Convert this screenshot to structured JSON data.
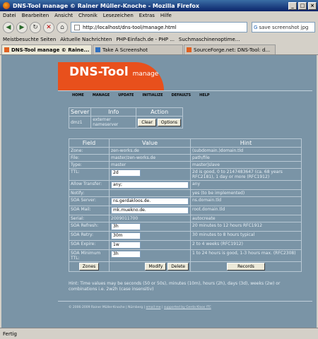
{
  "window": {
    "title": "DNS-Tool manage © Rainer Müller-Knoche - Mozilla Firefox"
  },
  "menubar": [
    "Datei",
    "Bearbeiten",
    "Ansicht",
    "Chronik",
    "Lesezeichen",
    "Extras",
    "Hilfe"
  ],
  "address": {
    "url": "http://localhost/dns-tool/manage.html"
  },
  "search": {
    "value": "save screenshot jpg"
  },
  "bookmarks": [
    "Meistbesuchte Seiten",
    "Aktuelle Nachrichten",
    "PHP-Einfach.de - PHP ...",
    "Suchmaschinenoptime..."
  ],
  "tabs": [
    "DNS-Tool manage © Raine...",
    "Take A Screenshot",
    "SourceForge.net: DNS-Tool: d..."
  ],
  "banner": {
    "title": "DNS-Tool",
    "subtitle": "manage"
  },
  "nav": [
    "HOME",
    "MANAGE",
    "UPDATE",
    "INITIALIZE",
    "DEFAULTS",
    "HELP"
  ],
  "actions_table": {
    "headers": {
      "server": "Server",
      "info": "Info",
      "action": "Action"
    },
    "row": {
      "server": "dmz1",
      "info": "externer nameserver",
      "clear": "Clear",
      "options": "Options"
    }
  },
  "fields_table": {
    "headers": {
      "field": "Field",
      "value": "Value",
      "hint": "Hint"
    },
    "rows": [
      {
        "field": "Zone:",
        "value": "zen-works.de",
        "input": false,
        "hint": "(subdomain.)domain.tld"
      },
      {
        "field": "File:",
        "value": "master/zen-works.de",
        "input": false,
        "hint": "path/file"
      },
      {
        "field": "Type:",
        "value": "master",
        "input": false,
        "hint": "master|slave"
      },
      {
        "field": "TTL:",
        "value": "2d",
        "input": true,
        "hint": "2d is good, 0 to 2147483647 (ca. 68 years RFC2181), 1 day or more (RFC1912)"
      },
      {
        "field": "Allow Transfer:",
        "value": "any;",
        "input": true,
        "hint": "any"
      },
      {
        "field": "Notify:",
        "value": "",
        "input": false,
        "hint": "yes (to be implemented)"
      },
      {
        "field": "SOA Server:",
        "value": "ns.gerdakloos.de.",
        "input": true,
        "hint": "ns.domain.tld"
      },
      {
        "field": "SOA Mail:",
        "value": "mk.muekno.de.",
        "input": true,
        "hint": "root.domain.tld"
      },
      {
        "field": "Serial:",
        "value": "2009011700",
        "input": false,
        "hint": "autocreate"
      },
      {
        "field": "SOA Refresh:",
        "value": "3h",
        "input": true,
        "hint": "20 minutes to 12 hours RFC1912"
      },
      {
        "field": "SOA Retry:",
        "value": "30m",
        "input": true,
        "hint": "30 minutes to 8 hours typical"
      },
      {
        "field": "SOA Expire:",
        "value": "1w",
        "input": true,
        "hint": "2 to 4 weeks (RFC1912)"
      },
      {
        "field": "SOA Minimum TTL:",
        "value": "3h",
        "input": true,
        "hint": "1 to 24 hours is good, 1-3 hours max. (RFC2308)"
      }
    ],
    "buttons": {
      "zones": "Zones",
      "modify": "Modify",
      "delete": "Delete",
      "records": "Records"
    }
  },
  "hint_text": "Hint: Time values may be seconds (50 or 50s), minutes (10m), hours (2h), days (3d), weeks (2w) or combinations i.e. 2w2h (case insensitiv)",
  "footer": {
    "copyright": "© 2006-2009 Rainer Müller-Knoche | Nürnberg |",
    "link1": "email me",
    "sep": "|",
    "link2": "supported by Gerda Kloos ITC"
  },
  "status": {
    "text": "Fertig"
  }
}
